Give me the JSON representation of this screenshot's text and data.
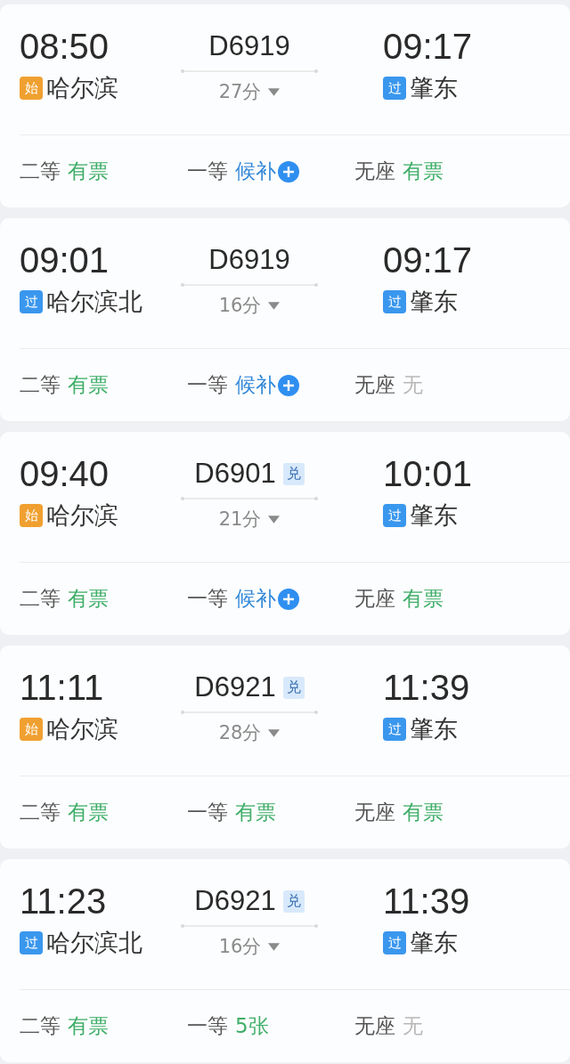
{
  "trains": [
    {
      "depart_time": "08:50",
      "depart_station": {
        "badge": "始",
        "kind": "start",
        "name": "哈尔滨"
      },
      "train_no": "D6919",
      "duration": "27分",
      "arrive_time": "09:17",
      "arrive_station": {
        "badge": "过",
        "kind": "pass",
        "name": "肇东"
      },
      "seats": [
        {
          "class": "二等",
          "status": "有票",
          "kind": "available"
        },
        {
          "class": "一等",
          "status": "候补",
          "kind": "waitlist"
        },
        {
          "class": "无座",
          "status": "有票",
          "kind": "available"
        }
      ]
    },
    {
      "depart_time": "09:01",
      "depart_station": {
        "badge": "过",
        "kind": "pass",
        "name": "哈尔滨北"
      },
      "train_no": "D6919",
      "duration": "16分",
      "arrive_time": "09:17",
      "arrive_station": {
        "badge": "过",
        "kind": "pass",
        "name": "肇东"
      },
      "seats": [
        {
          "class": "二等",
          "status": "有票",
          "kind": "available"
        },
        {
          "class": "一等",
          "status": "候补",
          "kind": "waitlist"
        },
        {
          "class": "无座",
          "status": "无",
          "kind": "none"
        }
      ]
    },
    {
      "depart_time": "09:40",
      "depart_station": {
        "badge": "始",
        "kind": "start",
        "name": "哈尔滨"
      },
      "train_no": "D6901",
      "tag": "兑",
      "duration": "21分",
      "arrive_time": "10:01",
      "arrive_station": {
        "badge": "过",
        "kind": "pass",
        "name": "肇东"
      },
      "seats": [
        {
          "class": "二等",
          "status": "有票",
          "kind": "available"
        },
        {
          "class": "一等",
          "status": "候补",
          "kind": "waitlist"
        },
        {
          "class": "无座",
          "status": "有票",
          "kind": "available"
        }
      ]
    },
    {
      "depart_time": "11:11",
      "depart_station": {
        "badge": "始",
        "kind": "start",
        "name": "哈尔滨"
      },
      "train_no": "D6921",
      "tag": "兑",
      "duration": "28分",
      "arrive_time": "11:39",
      "arrive_station": {
        "badge": "过",
        "kind": "pass",
        "name": "肇东"
      },
      "seats": [
        {
          "class": "二等",
          "status": "有票",
          "kind": "available"
        },
        {
          "class": "一等",
          "status": "有票",
          "kind": "available"
        },
        {
          "class": "无座",
          "status": "有票",
          "kind": "available"
        }
      ]
    },
    {
      "depart_time": "11:23",
      "depart_station": {
        "badge": "过",
        "kind": "pass",
        "name": "哈尔滨北"
      },
      "train_no": "D6921",
      "tag": "兑",
      "duration": "16分",
      "arrive_time": "11:39",
      "arrive_station": {
        "badge": "过",
        "kind": "pass",
        "name": "肇东"
      },
      "seats": [
        {
          "class": "二等",
          "status": "有票",
          "kind": "available"
        },
        {
          "class": "一等",
          "status": "5张",
          "kind": "available"
        },
        {
          "class": "无座",
          "status": "无",
          "kind": "none"
        }
      ]
    }
  ]
}
